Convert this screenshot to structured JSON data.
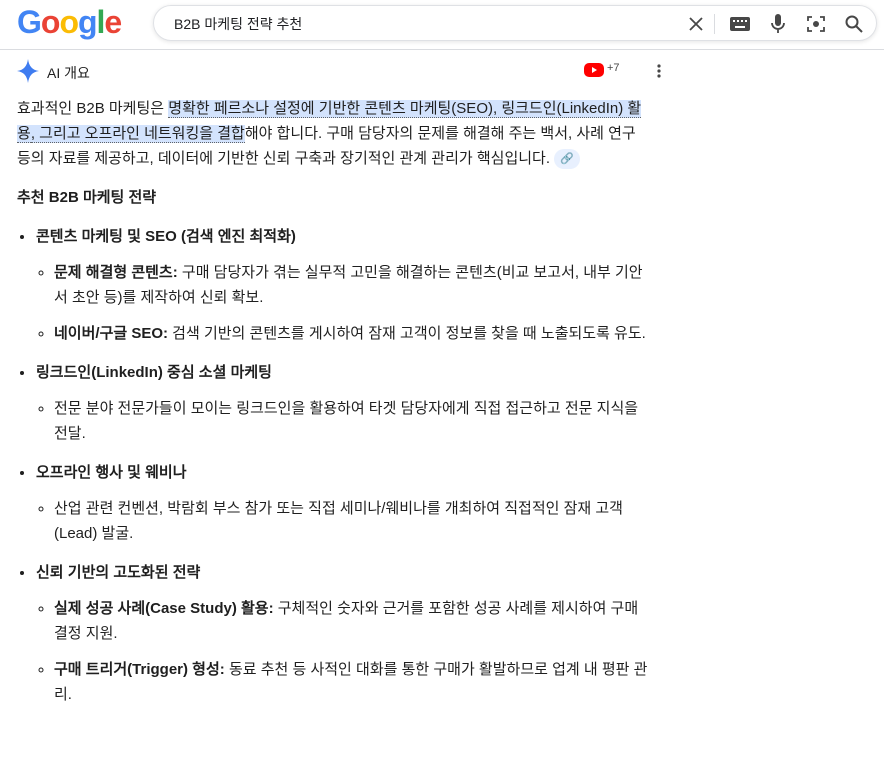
{
  "header": {
    "logo": [
      "G",
      "o",
      "o",
      "g",
      "l",
      "e"
    ],
    "search_value": "B2B 마케팅 전략 추천"
  },
  "ai_overview": {
    "title": "AI 개요",
    "sources_count": "+7"
  },
  "summary": {
    "pre": "효과적인 B2B 마케팅은 ",
    "hl1": "명확한 페르소나 설정에 기반한 ",
    "hl2": "콘텐츠 마케팅(SEO), 링크드인(LinkedIn) 활용",
    "hl3": ", 그리고 ",
    "hl4": "오프라인 네트워킹을 결합",
    "post": "해야 합니다. 구매 담당자의 문제를 해결해 주는 백서, 사례 연구 등의 자료를 제공하고, 데이터에 기반한 신뢰 구축과 장기적인 관계 관리가 핵심입니다."
  },
  "heading": "추천 B2B 마케팅 전략",
  "strategies": [
    {
      "title": "콘텐츠 마케팅 및 SEO (검색 엔진 최적화)",
      "items": [
        {
          "label": "문제 해결형 콘텐츠:",
          "text": " 구매 담당자가 겪는 실무적 고민을 해결하는 콘텐츠(비교 보고서, 내부 기안서 초안 등)를 제작하여 신뢰 확보."
        },
        {
          "label": "네이버/구글 SEO:",
          "text": " 검색 기반의 콘텐츠를 게시하여 잠재 고객이 정보를 찾을 때 노출되도록 유도."
        }
      ]
    },
    {
      "title": "링크드인(LinkedIn) 중심 소셜 마케팅",
      "items": [
        {
          "label": "",
          "text": "전문 분야 전문가들이 모이는 링크드인을 활용하여 타겟 담당자에게 직접 접근하고 전문 지식을 전달."
        }
      ]
    },
    {
      "title": "오프라인 행사 및 웨비나",
      "items": [
        {
          "label": "",
          "text": "산업 관련 컨벤션, 박람회 부스 참가 또는 직접 세미나/웨비나를 개최하여 직접적인 잠재 고객(Lead) 발굴."
        }
      ]
    },
    {
      "title": "신뢰 기반의 고도화된 전략",
      "items": [
        {
          "label": "실제 성공 사례(Case Study) 활용:",
          "text": " 구체적인 숫자와 근거를 포함한 성공 사례를 제시하여 구매 결정 지원."
        },
        {
          "label": "구매 트리거(Trigger) 형성:",
          "text": " 동료 추천 등 사적인 대화를 통한 구매가 활발하므로 업계 내 평판 관리."
        }
      ]
    }
  ]
}
